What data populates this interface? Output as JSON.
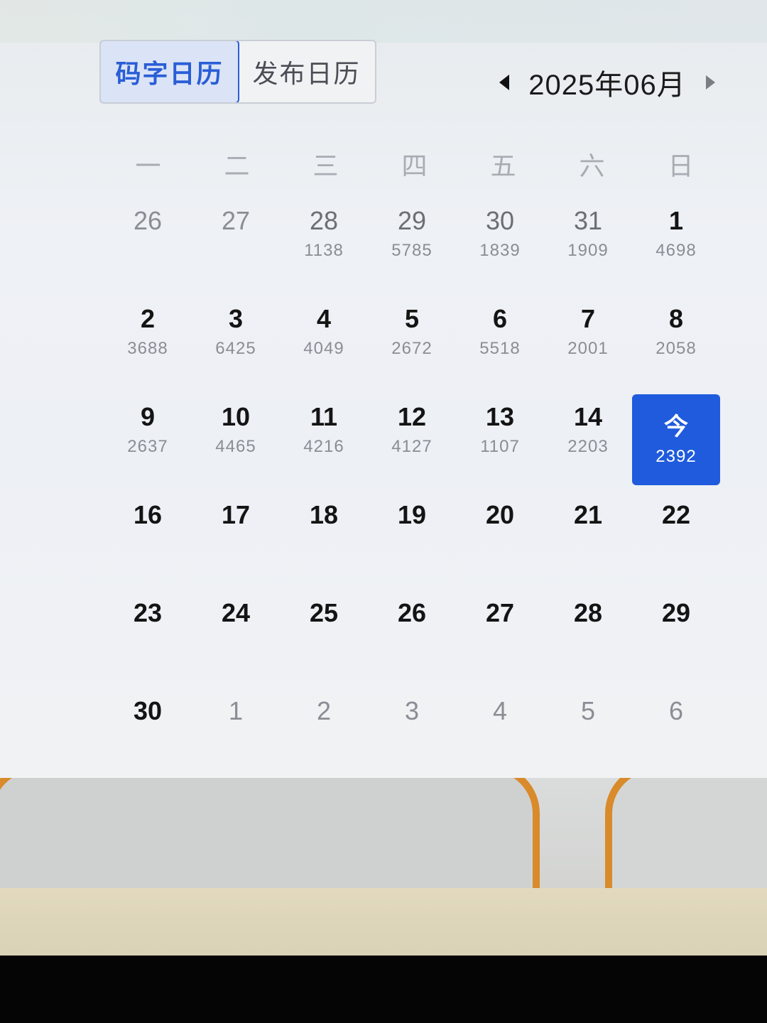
{
  "tabs": [
    {
      "label": "码字日历",
      "active": true
    },
    {
      "label": "发布日历",
      "active": false
    }
  ],
  "month_nav": {
    "label": "2025年06月",
    "prev_icon": "caret-left-icon",
    "next_icon": "caret-right-icon"
  },
  "weekdays": [
    "一",
    "二",
    "三",
    "四",
    "五",
    "六",
    "日"
  ],
  "days": [
    {
      "num": "26",
      "count": "",
      "type": "other"
    },
    {
      "num": "27",
      "count": "",
      "type": "other"
    },
    {
      "num": "28",
      "count": "1138",
      "type": "prev-bold"
    },
    {
      "num": "29",
      "count": "5785",
      "type": "prev-bold"
    },
    {
      "num": "30",
      "count": "1839",
      "type": "prev-bold"
    },
    {
      "num": "31",
      "count": "1909",
      "type": "prev-bold"
    },
    {
      "num": "1",
      "count": "4698",
      "type": "current"
    },
    {
      "num": "2",
      "count": "3688",
      "type": "current"
    },
    {
      "num": "3",
      "count": "6425",
      "type": "current"
    },
    {
      "num": "4",
      "count": "4049",
      "type": "current"
    },
    {
      "num": "5",
      "count": "2672",
      "type": "current"
    },
    {
      "num": "6",
      "count": "5518",
      "type": "current"
    },
    {
      "num": "7",
      "count": "2001",
      "type": "current"
    },
    {
      "num": "8",
      "count": "2058",
      "type": "current"
    },
    {
      "num": "9",
      "count": "2637",
      "type": "current"
    },
    {
      "num": "10",
      "count": "4465",
      "type": "current"
    },
    {
      "num": "11",
      "count": "4216",
      "type": "current"
    },
    {
      "num": "12",
      "count": "4127",
      "type": "current"
    },
    {
      "num": "13",
      "count": "1107",
      "type": "current"
    },
    {
      "num": "14",
      "count": "2203",
      "type": "current"
    },
    {
      "num": "今",
      "count": "2392",
      "type": "today"
    },
    {
      "num": "16",
      "count": "",
      "type": "current"
    },
    {
      "num": "17",
      "count": "",
      "type": "current"
    },
    {
      "num": "18",
      "count": "",
      "type": "current"
    },
    {
      "num": "19",
      "count": "",
      "type": "current"
    },
    {
      "num": "20",
      "count": "",
      "type": "current"
    },
    {
      "num": "21",
      "count": "",
      "type": "current"
    },
    {
      "num": "22",
      "count": "",
      "type": "current"
    },
    {
      "num": "23",
      "count": "",
      "type": "current"
    },
    {
      "num": "24",
      "count": "",
      "type": "current"
    },
    {
      "num": "25",
      "count": "",
      "type": "current"
    },
    {
      "num": "26",
      "count": "",
      "type": "current"
    },
    {
      "num": "27",
      "count": "",
      "type": "current"
    },
    {
      "num": "28",
      "count": "",
      "type": "current"
    },
    {
      "num": "29",
      "count": "",
      "type": "current"
    },
    {
      "num": "30",
      "count": "",
      "type": "current"
    },
    {
      "num": "1",
      "count": "",
      "type": "other"
    },
    {
      "num": "2",
      "count": "",
      "type": "other"
    },
    {
      "num": "3",
      "count": "",
      "type": "other"
    },
    {
      "num": "4",
      "count": "",
      "type": "other"
    },
    {
      "num": "5",
      "count": "",
      "type": "other"
    },
    {
      "num": "6",
      "count": "",
      "type": "other"
    }
  ],
  "colors": {
    "accent": "#1f5bdc",
    "tab_active_text": "#2a5ed6",
    "muted_text": "#8a8d94"
  }
}
